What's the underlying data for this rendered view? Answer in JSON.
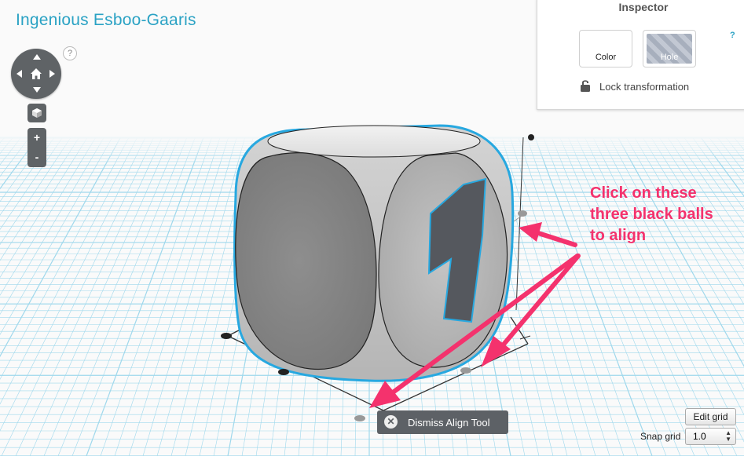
{
  "project_title": "Ingenious Esboo-Gaaris",
  "help_label": "?",
  "view_controls": {
    "zoom_in": "+",
    "zoom_out": "-"
  },
  "inspector": {
    "title": "Inspector",
    "help": "?",
    "color_label": "Color",
    "hole_label": "Hole",
    "lock_label": "Lock transformation"
  },
  "annotation": {
    "line1": "Click on these",
    "line2": "three black balls",
    "line3": "to align"
  },
  "dismiss_label": "Dismiss Align Tool",
  "grid": {
    "edit_label": "Edit grid",
    "snap_label": "Snap grid",
    "snap_value": "1.0"
  },
  "object": {
    "face_numeral": "1"
  },
  "colors": {
    "accent": "#2aa2c4",
    "annotation": "#f4326d",
    "grid_line": "#9fd8ec",
    "selection": "#27a8e0"
  }
}
